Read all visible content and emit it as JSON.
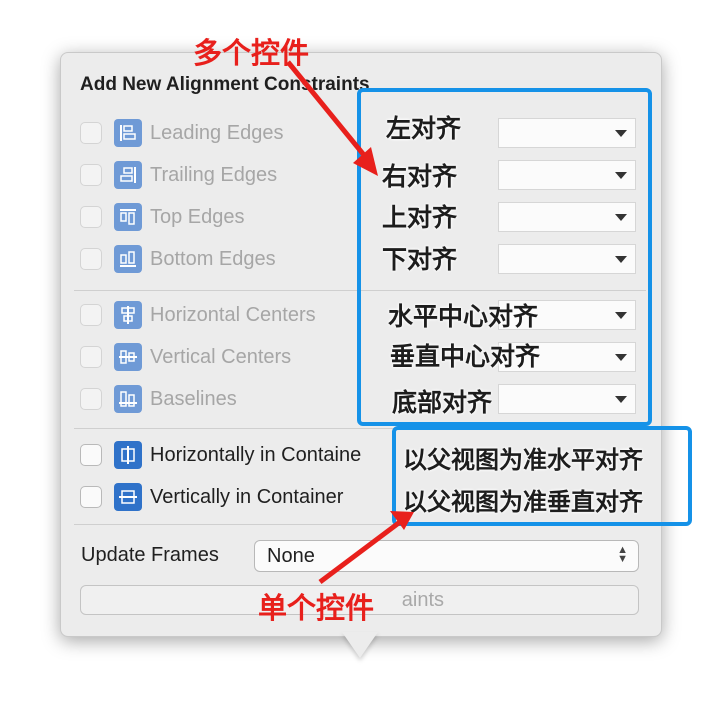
{
  "title": "Add New Alignment Constraints",
  "rows": [
    {
      "label": "Leading Edges",
      "icon": "leading-edges-icon"
    },
    {
      "label": "Trailing Edges",
      "icon": "trailing-edges-icon"
    },
    {
      "label": "Top Edges",
      "icon": "top-edges-icon"
    },
    {
      "label": "Bottom Edges",
      "icon": "bottom-edges-icon"
    },
    {
      "label": "Horizontal Centers",
      "icon": "horizontal-centers-icon"
    },
    {
      "label": "Vertical Centers",
      "icon": "vertical-centers-icon"
    },
    {
      "label": "Baselines",
      "icon": "baselines-icon"
    },
    {
      "label": "Horizontally in Containe",
      "icon": "horizontally-in-container-icon"
    },
    {
      "label": "Vertically in Container",
      "icon": "vertically-in-container-icon"
    }
  ],
  "annotations": {
    "multi_label": "多个控件",
    "single_label": "单个控件",
    "left": "左对齐",
    "right": "右对齐",
    "top": "上对齐",
    "bottom": "下对齐",
    "hcenter": "水平中心对齐",
    "vcenter": "垂直中心对齐",
    "baseline": "底部对齐",
    "h_container": "以父视图为准水平对齐",
    "v_container": "以父视图为准垂直对齐"
  },
  "update_frames": {
    "label": "Update Frames",
    "value": "None"
  },
  "add_button": {
    "label": "aints"
  },
  "colors": {
    "annotation_red": "#e8201c",
    "annotation_blue": "#1592e8",
    "icon_blue": "#2f72c9"
  }
}
